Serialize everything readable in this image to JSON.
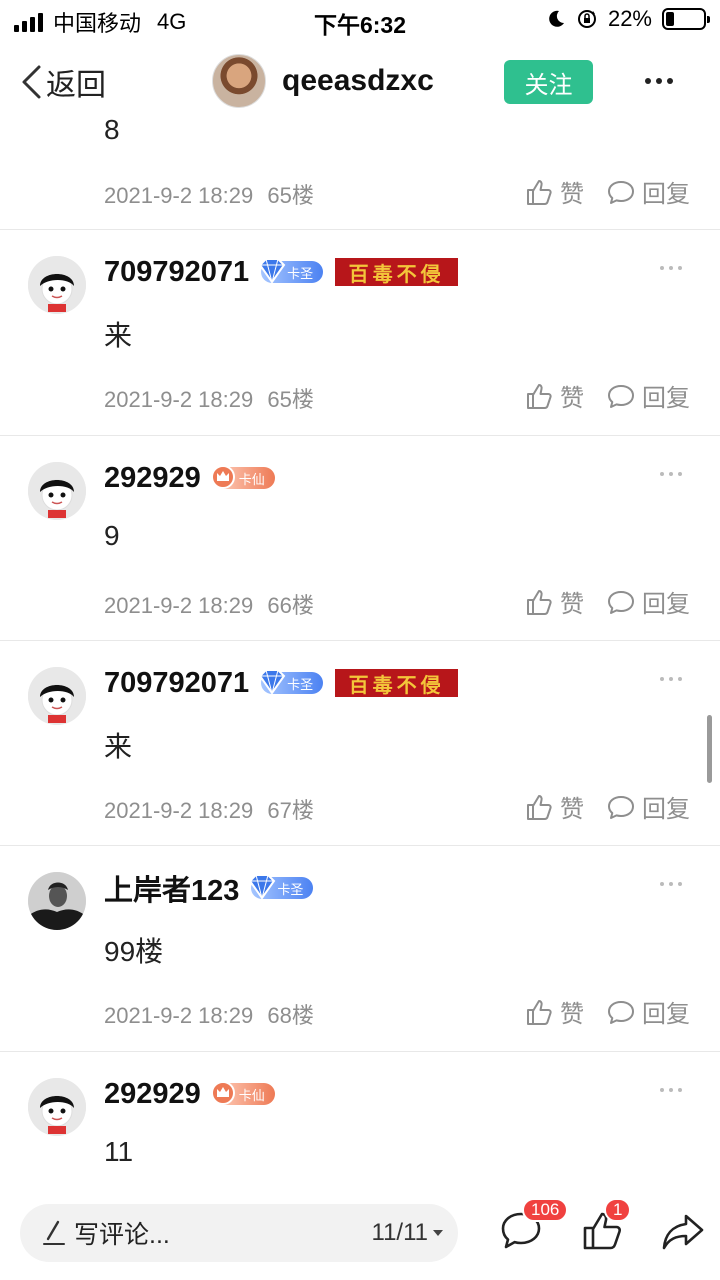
{
  "status_bar": {
    "carrier": "中国移动",
    "network": "4G",
    "time": "下午6:32",
    "battery": "22%",
    "battery_level": 0.22
  },
  "header": {
    "back_label": "返回",
    "username": "qeeasdzxc",
    "follow_label": "关注"
  },
  "posts": [
    {
      "content": "8",
      "date": "2021-9-2 18:29",
      "floor": "65楼"
    },
    {
      "username": "709792071",
      "badge": "卡圣",
      "title_tag": "百毒不侵",
      "content": "来",
      "date": "2021-9-2 18:29",
      "floor": "65楼"
    },
    {
      "username": "292929",
      "badge": "卡仙",
      "content": "9",
      "date": "2021-9-2 18:29",
      "floor": "66楼"
    },
    {
      "username": "709792071",
      "badge": "卡圣",
      "title_tag": "百毒不侵",
      "content": "来",
      "date": "2021-9-2 18:29",
      "floor": "67楼"
    },
    {
      "username": "上岸者123",
      "badge": "卡圣",
      "content": "99楼",
      "date": "2021-9-2 18:29",
      "floor": "68楼"
    },
    {
      "username": "292929",
      "badge": "卡仙",
      "content": "11"
    }
  ],
  "actions": {
    "like_label": "赞",
    "reply_label": "回复"
  },
  "bottom_bar": {
    "comment_placeholder": "写评论...",
    "page_indicator": "11/11",
    "comment_count": "106",
    "like_count": "1"
  },
  "colors": {
    "accent_green": "#2fc08f",
    "badge_red": "#f0413f",
    "title_tag_bg": "#b7161a",
    "title_tag_text": "#f3c63a"
  },
  "icons": [
    "signal-icon",
    "moon-icon",
    "rotation-lock-icon",
    "battery-icon",
    "back-chevron-icon",
    "more-icon",
    "thumbs-up-icon",
    "comment-bubble-icon",
    "pen-icon",
    "caret-down-icon",
    "share-arrow-icon",
    "gem-icon",
    "crown-icon"
  ]
}
